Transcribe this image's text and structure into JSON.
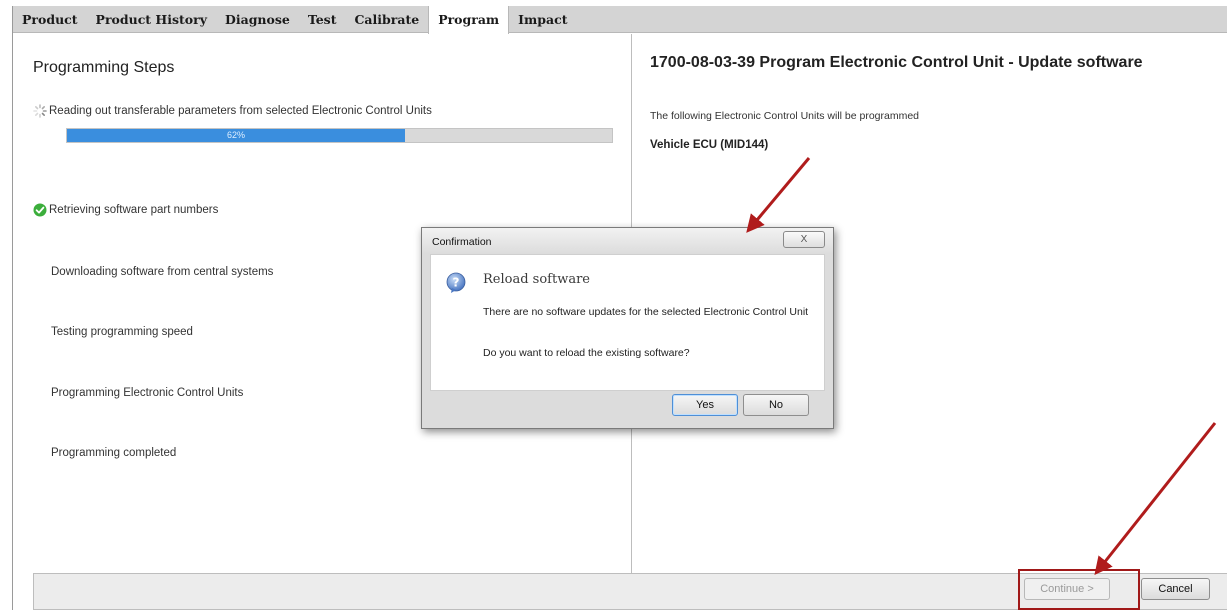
{
  "tabs": [
    {
      "label": "Product",
      "active": false
    },
    {
      "label": "Product History",
      "active": false
    },
    {
      "label": "Diagnose",
      "active": false
    },
    {
      "label": "Test",
      "active": false
    },
    {
      "label": "Calibrate",
      "active": false
    },
    {
      "label": "Program",
      "active": true
    },
    {
      "label": "Impact",
      "active": false
    }
  ],
  "left": {
    "title": "Programming Steps",
    "steps": [
      {
        "label": "Reading out transferable parameters from selected Electronic Control Units",
        "status": "in-progress",
        "icon": "spinner-icon"
      },
      {
        "label": "Retrieving software part numbers",
        "status": "done",
        "icon": "check-circle-icon"
      },
      {
        "label": "Downloading software from central systems",
        "status": "pending"
      },
      {
        "label": "Testing programming speed",
        "status": "pending"
      },
      {
        "label": "Programming Electronic Control Units",
        "status": "pending"
      },
      {
        "label": "Programming completed",
        "status": "pending"
      }
    ],
    "progress": {
      "value": 62,
      "label": "62%"
    }
  },
  "right": {
    "title": "1700-08-03-39 Program Electronic Control Unit - Update software",
    "subtitle": "The following Electronic Control Units will be programmed",
    "ecu": "Vehicle ECU (MID144)"
  },
  "dialog": {
    "title": "Confirmation",
    "close_label": "X",
    "heading": "Reload software",
    "message": "There are no software updates for the selected Electronic Control Unit",
    "question": "Do you want to reload the existing software?",
    "yes_label": "Yes",
    "no_label": "No"
  },
  "footer": {
    "continue_label": "Continue >",
    "cancel_label": "Cancel"
  },
  "colors": {
    "progress_fill": "#3a8ede",
    "annotation_red": "#b01c1c",
    "check_green": "#3cae3c"
  }
}
